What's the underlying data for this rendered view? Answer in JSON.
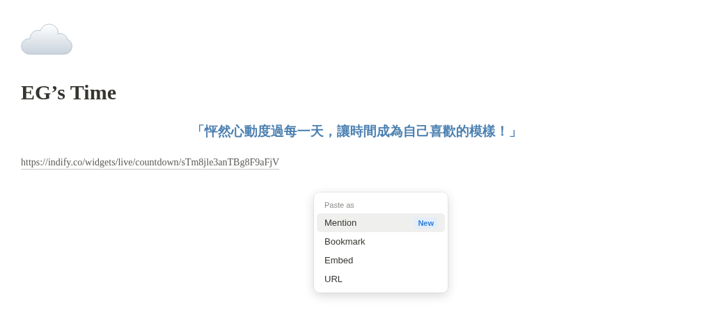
{
  "page": {
    "title": "EG’s Time",
    "quote": "「怦然心動度過每一天，讓時間成為自己喜歡的模樣！」",
    "link": "https://indify.co/widgets/live/countdown/sTm8jle3anTBg8F9aFjV"
  },
  "paste_menu": {
    "heading": "Paste as",
    "items": [
      {
        "label": "Mention",
        "selected": true,
        "badge": "New"
      },
      {
        "label": "Bookmark",
        "selected": false
      },
      {
        "label": "Embed",
        "selected": false
      },
      {
        "label": "URL",
        "selected": false
      }
    ]
  }
}
